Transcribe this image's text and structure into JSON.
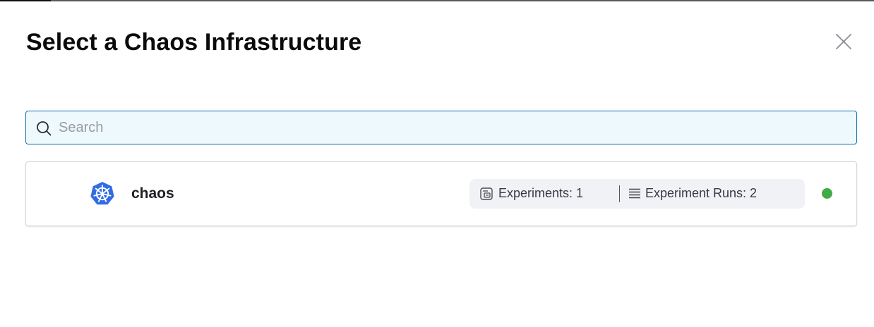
{
  "dialog": {
    "title": "Select a Chaos Infrastructure",
    "close_icon": "close-icon"
  },
  "search": {
    "placeholder": "Search",
    "value": "",
    "icon": "search-icon"
  },
  "infrastructures": [
    {
      "name": "chaos",
      "icon": "kubernetes-icon",
      "experiments_label": "Experiments: 1",
      "experiment_runs_label": "Experiment Runs: 2",
      "status": "active",
      "status_color": "#42ab45"
    }
  ],
  "colors": {
    "accent": "#0f6fb0",
    "kubernetes": "#326ce5",
    "status_active": "#42ab45"
  }
}
